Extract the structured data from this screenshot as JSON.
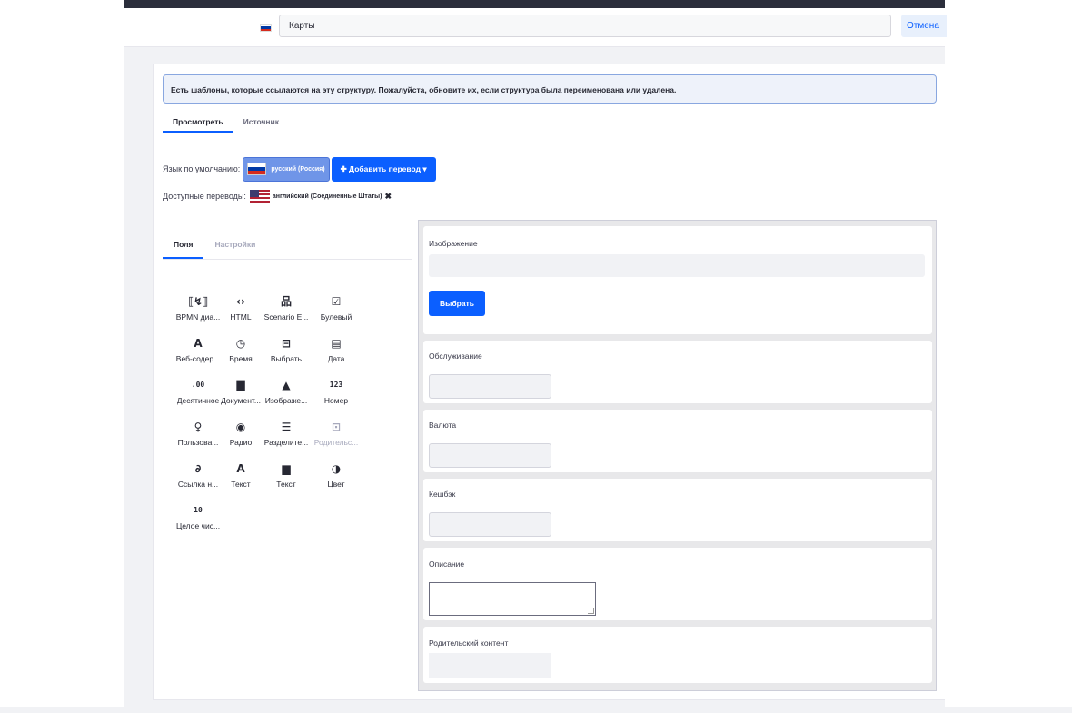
{
  "header": {
    "structure_name": "Карты",
    "cancel_label": "Отмена",
    "colors": {
      "topbar": "#2b2e3c",
      "accent": "#0b5fff"
    }
  },
  "alert": {
    "text": "Есть шаблоны, которые ссылаются на эту структуру. Пожалуйста, обновите их, если структура была переименована или удалена."
  },
  "tabs": [
    {
      "label": "Просмотреть",
      "active": true
    },
    {
      "label": "Источник",
      "active": false
    }
  ],
  "language": {
    "default_label": "Язык по умолчанию:",
    "default_value": "русский (Россия)",
    "add_translation_label": "✚ Добавить перевод ▾",
    "available_label": "Доступные переводы:",
    "available_value": "английский (Соединенные Штаты)",
    "remove_icon": "close-icon"
  },
  "left_tabs": [
    {
      "label": "Поля",
      "active": true
    },
    {
      "label": "Настройки",
      "active": false
    }
  ],
  "fields": [
    {
      "icon": "bpmn-icon",
      "glyph": "⟦↯⟧",
      "label": "BPMN диа..."
    },
    {
      "icon": "code-icon",
      "glyph": "‹›",
      "label": "HTML"
    },
    {
      "icon": "sitemap-icon",
      "glyph": "品",
      "label": "Scenario E..."
    },
    {
      "icon": "checkbox-icon",
      "glyph": "☑",
      "label": "Булевый"
    },
    {
      "icon": "letter-a-icon",
      "glyph": "A",
      "label": "Веб-содер..."
    },
    {
      "icon": "clock-icon",
      "glyph": "◷",
      "label": "Время"
    },
    {
      "icon": "select-icon",
      "glyph": "⊟",
      "label": "Выбрать"
    },
    {
      "icon": "calendar-icon",
      "glyph": "▤",
      "label": "Дата"
    },
    {
      "icon": "decimal-icon",
      "glyph": ".00",
      "label": "Десятичное"
    },
    {
      "icon": "document-icon",
      "glyph": "▇",
      "label": "Документ..."
    },
    {
      "icon": "image-icon",
      "glyph": "▲",
      "label": "Изображе..."
    },
    {
      "icon": "number-icon",
      "glyph": "123",
      "label": "Номер"
    },
    {
      "icon": "user-icon",
      "glyph": "♀",
      "label": "Пользова..."
    },
    {
      "icon": "radio-icon",
      "glyph": "◉",
      "label": "Радио"
    },
    {
      "icon": "separator-icon",
      "glyph": "☰",
      "label": "Разделите..."
    },
    {
      "icon": "archive-icon",
      "glyph": "⊡",
      "label": "Родительс...",
      "disabled": true
    },
    {
      "icon": "link-icon",
      "glyph": "∂",
      "label": "Ссылка н..."
    },
    {
      "icon": "text-icon",
      "glyph": "A",
      "label": "Текст"
    },
    {
      "icon": "rich-text-icon",
      "glyph": "▆",
      "label": "Текст"
    },
    {
      "icon": "color-icon",
      "glyph": "◑",
      "label": "Цвет"
    },
    {
      "icon": "integer-icon",
      "glyph": "10",
      "label": "Целое чис..."
    }
  ],
  "form": {
    "image_label": "Изображение",
    "choose_button": "Выбрать",
    "service_label": "Обслуживание",
    "currency_label": "Валюта",
    "cashback_label": "Кешбэк",
    "description_label": "Описание",
    "parent_label": "Родительский контент"
  }
}
